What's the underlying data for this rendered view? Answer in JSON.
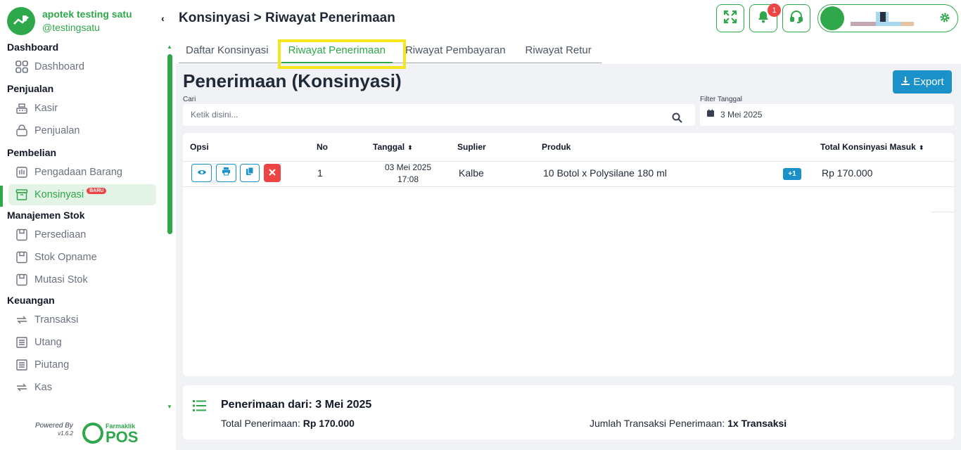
{
  "brand": {
    "name": "apotek testing satu",
    "username": "@testingsatu"
  },
  "sidebar": {
    "sections": [
      {
        "title": "Dashboard",
        "items": [
          {
            "label": "Dashboard",
            "icon": "grid-icon"
          }
        ]
      },
      {
        "title": "Penjualan",
        "items": [
          {
            "label": "Kasir",
            "icon": "cash-register-icon"
          },
          {
            "label": "Penjualan",
            "icon": "shopping-basket-icon"
          }
        ]
      },
      {
        "title": "Pembelian",
        "items": [
          {
            "label": "Pengadaan Barang",
            "icon": "procurement-icon"
          },
          {
            "label": "Konsinyasi",
            "icon": "box-icon",
            "badge": "BARU",
            "active": true
          }
        ]
      },
      {
        "title": "Manajemen Stok",
        "items": [
          {
            "label": "Persediaan",
            "icon": "inventory-icon"
          },
          {
            "label": "Stok Opname",
            "icon": "inventory-icon"
          },
          {
            "label": "Mutasi Stok",
            "icon": "inventory-icon"
          }
        ]
      },
      {
        "title": "Keuangan",
        "items": [
          {
            "label": "Transaksi",
            "icon": "transfer-icon"
          },
          {
            "label": "Utang",
            "icon": "receipt-icon"
          },
          {
            "label": "Piutang",
            "icon": "receipt-icon"
          },
          {
            "label": "Kas",
            "icon": "transfer-icon"
          }
        ]
      }
    ],
    "powered_by": "Powered By",
    "version": "v1.6.2",
    "logo_small": "Farmaklik",
    "logo_big": "POS"
  },
  "header": {
    "breadcrumb": "Konsinyasi > Riwayat Penerimaan",
    "notification_count": "1"
  },
  "tabs": [
    "Daftar Konsinyasi",
    "Riwayat Penerimaan",
    "Riwayat Pembayaran",
    "Riwayat Retur"
  ],
  "active_tab": "Riwayat Penerimaan",
  "page": {
    "title": "Penerimaan (Konsinyasi)",
    "export_label": "Export",
    "search_label": "Cari",
    "search_placeholder": "Ketik disini...",
    "filter_label": "Filter Tanggal",
    "filter_value": "3 Mei 2025"
  },
  "table": {
    "columns": {
      "opsi": "Opsi",
      "no": "No",
      "tanggal": "Tanggal",
      "suplier": "Suplier",
      "produk": "Produk",
      "total": "Total Konsinyasi Masuk"
    },
    "rows": [
      {
        "no": "1",
        "date": "03 Mei 2025",
        "time": "17:08",
        "supplier": "Kalbe",
        "product": "10 Botol x Polysilane 180 ml",
        "more": "+1",
        "total": "Rp 170.000"
      }
    ]
  },
  "summary": {
    "title": "Penerimaan dari: 3 Mei 2025",
    "total_label": "Total Penerimaan:",
    "total_value": "Rp 170.000",
    "count_label": "Jumlah Transaksi Penerimaan:",
    "count_value": "1x Transaksi"
  },
  "colors": {
    "primary": "#2ea84a",
    "accent": "#1b91c9",
    "danger": "#ef4444",
    "highlight": "#f5e61a"
  }
}
